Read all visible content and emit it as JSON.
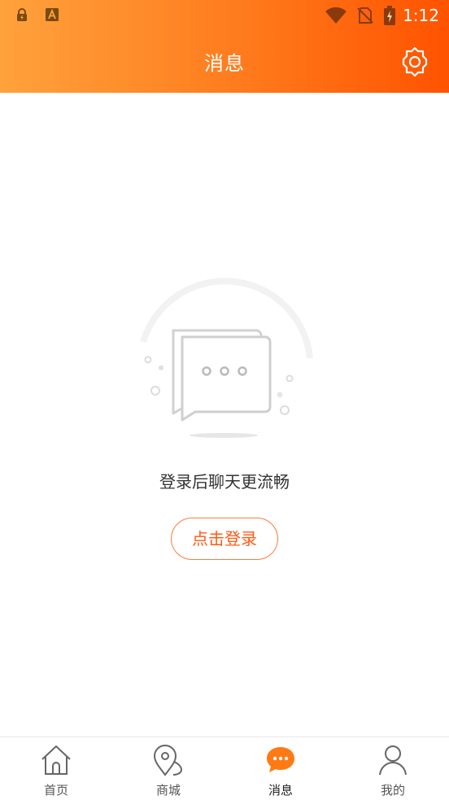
{
  "status_bar": {
    "time": "1:12",
    "icons": [
      "lock-icon",
      "font-a-icon",
      "wifi-icon",
      "no-sim-icon",
      "battery-charging-icon"
    ]
  },
  "header": {
    "title": "消息",
    "settings_icon": "gear-icon"
  },
  "empty_state": {
    "illustration": "chat-bubble-icon",
    "message": "登录后聊天更流畅",
    "login_button": "点击登录"
  },
  "tabbar": {
    "tabs": [
      {
        "label": "首页",
        "icon": "home-icon",
        "active": false
      },
      {
        "label": "商城",
        "icon": "map-pin-icon",
        "active": false
      },
      {
        "label": "消息",
        "icon": "message-icon",
        "active": true
      },
      {
        "label": "我的",
        "icon": "user-icon",
        "active": false
      }
    ]
  },
  "colors": {
    "header_gradient_start": "#ffa23c",
    "header_gradient_end": "#ff5300",
    "accent": "#ff6a1a",
    "text_primary": "#333333"
  }
}
